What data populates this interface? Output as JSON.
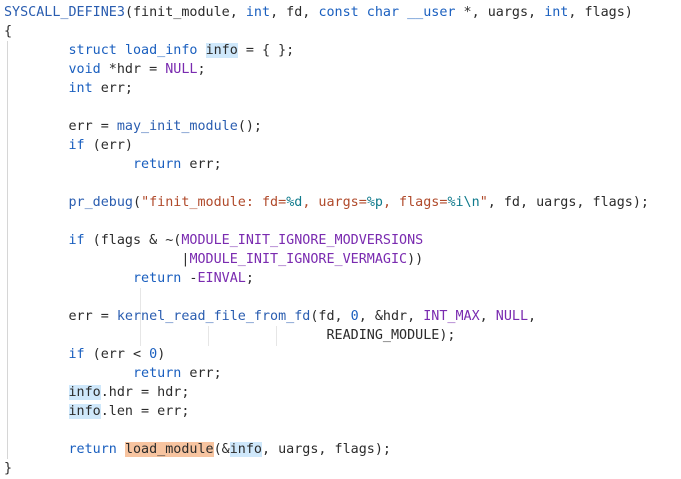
{
  "editor": {
    "lines": [
      [
        {
          "t": "SYSCALL_DEFINE3",
          "c": "fn"
        },
        {
          "t": "(finit_module, ",
          "c": "op"
        },
        {
          "t": "int",
          "c": "ty"
        },
        {
          "t": ", fd, ",
          "c": "op"
        },
        {
          "t": "const char",
          "c": "ty"
        },
        {
          "t": " ",
          "c": "op"
        },
        {
          "t": "__user",
          "c": "kw"
        },
        {
          "t": " *, uargs, ",
          "c": "op"
        },
        {
          "t": "int",
          "c": "ty"
        },
        {
          "t": ", flags)",
          "c": "op"
        }
      ],
      [
        {
          "t": "{",
          "c": "op"
        }
      ],
      [
        {
          "t": "        ",
          "c": "op"
        },
        {
          "t": "struct",
          "c": "kw"
        },
        {
          "t": " ",
          "c": "op"
        },
        {
          "t": "load_info",
          "c": "ty"
        },
        {
          "t": " ",
          "c": "op"
        },
        {
          "t": "info",
          "c": "hl"
        },
        {
          "t": " = { };",
          "c": "op"
        }
      ],
      [
        {
          "t": "        ",
          "c": "op"
        },
        {
          "t": "void",
          "c": "ty"
        },
        {
          "t": " *hdr = ",
          "c": "op"
        },
        {
          "t": "NULL",
          "c": "mac"
        },
        {
          "t": ";",
          "c": "op"
        }
      ],
      [
        {
          "t": "        ",
          "c": "op"
        },
        {
          "t": "int",
          "c": "ty"
        },
        {
          "t": " err;",
          "c": "op"
        }
      ],
      [],
      [
        {
          "t": "        err = ",
          "c": "op"
        },
        {
          "t": "may_init_module",
          "c": "fn"
        },
        {
          "t": "();",
          "c": "op"
        }
      ],
      [
        {
          "t": "        ",
          "c": "op"
        },
        {
          "t": "if",
          "c": "kw"
        },
        {
          "t": " (err)",
          "c": "op"
        }
      ],
      [
        {
          "t": "                ",
          "c": "op"
        },
        {
          "t": "return",
          "c": "kw"
        },
        {
          "t": " err;",
          "c": "op"
        }
      ],
      [],
      [
        {
          "t": "        ",
          "c": "op"
        },
        {
          "t": "pr_debug",
          "c": "fn"
        },
        {
          "t": "(",
          "c": "op"
        },
        {
          "t": "\"finit_module: fd=",
          "c": "str"
        },
        {
          "t": "%d",
          "c": "fmt"
        },
        {
          "t": ", uargs=",
          "c": "str"
        },
        {
          "t": "%p",
          "c": "fmt"
        },
        {
          "t": ", flags=",
          "c": "str"
        },
        {
          "t": "%i\\n",
          "c": "fmt"
        },
        {
          "t": "\"",
          "c": "str"
        },
        {
          "t": ", fd, uargs, flags);",
          "c": "op"
        }
      ],
      [],
      [
        {
          "t": "        ",
          "c": "op"
        },
        {
          "t": "if",
          "c": "kw"
        },
        {
          "t": " (flags & ~(",
          "c": "op"
        },
        {
          "t": "MODULE_INIT_IGNORE_MODVERSIONS",
          "c": "mac"
        }
      ],
      [
        {
          "t": "                      |",
          "c": "op"
        },
        {
          "t": "MODULE_INIT_IGNORE_VERMAGIC",
          "c": "mac"
        },
        {
          "t": "))",
          "c": "op"
        }
      ],
      [
        {
          "t": "                ",
          "c": "op"
        },
        {
          "t": "return",
          "c": "kw"
        },
        {
          "t": " -",
          "c": "op"
        },
        {
          "t": "EINVAL",
          "c": "mac"
        },
        {
          "t": ";",
          "c": "op"
        }
      ],
      [],
      [
        {
          "t": "        err = ",
          "c": "op"
        },
        {
          "t": "kernel_read_file_from_fd",
          "c": "fn"
        },
        {
          "t": "(fd, ",
          "c": "op"
        },
        {
          "t": "0",
          "c": "num"
        },
        {
          "t": ", &hdr, ",
          "c": "op"
        },
        {
          "t": "INT_MAX",
          "c": "mac"
        },
        {
          "t": ", ",
          "c": "op"
        },
        {
          "t": "NULL",
          "c": "mac"
        },
        {
          "t": ",",
          "c": "op"
        }
      ],
      [
        {
          "t": "                                        READING_MODULE);",
          "c": "op"
        }
      ],
      [
        {
          "t": "        ",
          "c": "op"
        },
        {
          "t": "if",
          "c": "kw"
        },
        {
          "t": " (err < ",
          "c": "op"
        },
        {
          "t": "0",
          "c": "num"
        },
        {
          "t": ")",
          "c": "op"
        }
      ],
      [
        {
          "t": "                ",
          "c": "op"
        },
        {
          "t": "return",
          "c": "kw"
        },
        {
          "t": " err;",
          "c": "op"
        }
      ],
      [
        {
          "t": "        ",
          "c": "op"
        },
        {
          "t": "info",
          "c": "hl"
        },
        {
          "t": ".hdr = hdr;",
          "c": "op"
        }
      ],
      [
        {
          "t": "        ",
          "c": "op"
        },
        {
          "t": "info",
          "c": "hl"
        },
        {
          "t": ".len = err;",
          "c": "op"
        }
      ],
      [],
      [
        {
          "t": "        ",
          "c": "op"
        },
        {
          "t": "return",
          "c": "kw"
        },
        {
          "t": " ",
          "c": "op"
        },
        {
          "t": "load_module",
          "c": "hl2"
        },
        {
          "t": "(&",
          "c": "op"
        },
        {
          "t": "info",
          "c": "hl"
        },
        {
          "t": ", uargs, flags);",
          "c": "op"
        }
      ],
      [
        {
          "t": "}",
          "c": "op"
        }
      ]
    ]
  }
}
